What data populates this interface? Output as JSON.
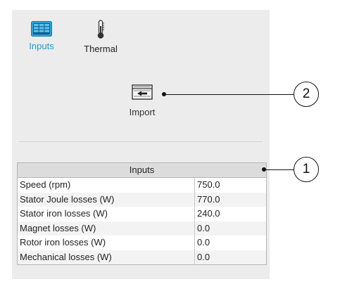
{
  "modes": {
    "inputs": {
      "label": "Inputs",
      "icon": "table-icon"
    },
    "thermal": {
      "label": "Thermal",
      "icon": "thermometer-icon"
    }
  },
  "import": {
    "label": "Import",
    "icon": "import-icon"
  },
  "table": {
    "title": "Inputs",
    "rows": [
      {
        "name": "Speed (rpm)",
        "value": "750.0"
      },
      {
        "name": "Stator Joule losses (W)",
        "value": "770.0"
      },
      {
        "name": "Stator iron losses (W)",
        "value": "240.0"
      },
      {
        "name": "Magnet losses (W)",
        "value": "0.0"
      },
      {
        "name": "Rotor iron losses (W)",
        "value": "0.0"
      },
      {
        "name": "Mechanical losses (W)",
        "value": "0.0"
      }
    ]
  },
  "callouts": {
    "one": "1",
    "two": "2"
  },
  "colors": {
    "accent": "#1f9bd1",
    "panel": "#ececec",
    "header": "#dcdcdc"
  }
}
